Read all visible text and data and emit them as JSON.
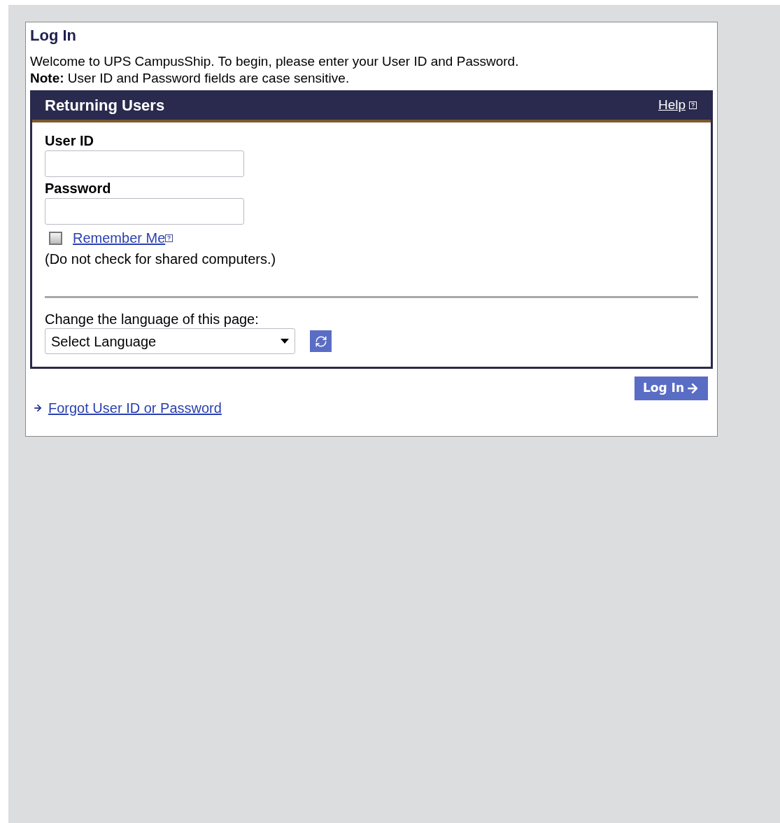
{
  "title": "Log In",
  "intro": "Welcome to UPS CampusShip. To begin, please enter your User ID and Password.",
  "note": "**Note:** User ID and Password fields are case sensitive.",
  "panel": {
    "title": "Returning Users",
    "help_link": "Help"
  },
  "fields": [
    {
      "label": "User ID"
    },
    {
      "label": "Password"
    }
  ],
  "remember": {
    "label": "Remember Me",
    "checked": false,
    "hint": "(Do not check for shared computers.)"
  },
  "language": {
    "label": "Change the language of this page:",
    "value": "Select Language"
  },
  "login_button": "Log In",
  "forgot_link": "Forgot User ID or Password"
}
